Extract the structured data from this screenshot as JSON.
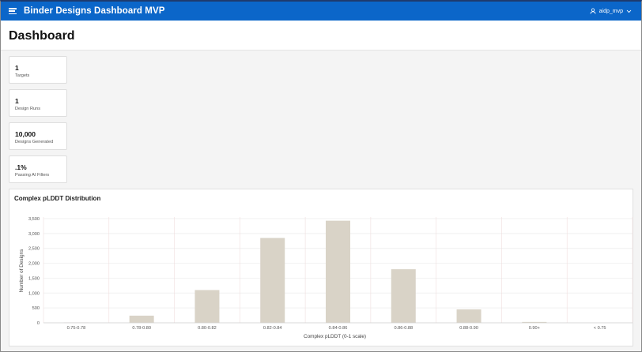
{
  "header": {
    "app_title": "Binder Designs Dashboard MVP",
    "username": "aidp_mvp",
    "menu_icon": "hamburger-menu-icon",
    "user_icon": "user-icon",
    "dropdown_icon": "chevron-down-icon",
    "accent_color": "#0b66c9"
  },
  "page": {
    "title": "Dashboard"
  },
  "cards": [
    {
      "value": "1",
      "label": "Targets"
    },
    {
      "value": "1",
      "label": "Design Runs"
    },
    {
      "value": "10,000",
      "label": "Designs Generated"
    },
    {
      "value": ".1%",
      "label": "Passing AI Filters"
    }
  ],
  "chart": {
    "region_title": "Complex pLDDT Distribution"
  },
  "chart_data": {
    "type": "bar",
    "title": "Complex pLDDT Distribution",
    "xlabel": "Complex pLDDT (0-1 scale)",
    "ylabel": "Number of Designs",
    "categories": [
      "0.75-0.78",
      "0.78-0.80",
      "0.80-0.82",
      "0.82-0.84",
      "0.84-0.86",
      "0.86-0.88",
      "0.88-0.90",
      "0.90+",
      "< 0.75"
    ],
    "values": [
      10,
      240,
      1100,
      2850,
      3430,
      1800,
      450,
      30,
      0
    ],
    "ylim": [
      0,
      3500
    ],
    "yticks": [
      0,
      500,
      1000,
      1500,
      2000,
      2500,
      3000,
      3500
    ],
    "ytick_labels": [
      "0",
      "500",
      "1,000",
      "1,500",
      "2,000",
      "2,500",
      "3,000",
      "3,500"
    ],
    "bar_color": "#d9d3c7",
    "grid": true
  }
}
